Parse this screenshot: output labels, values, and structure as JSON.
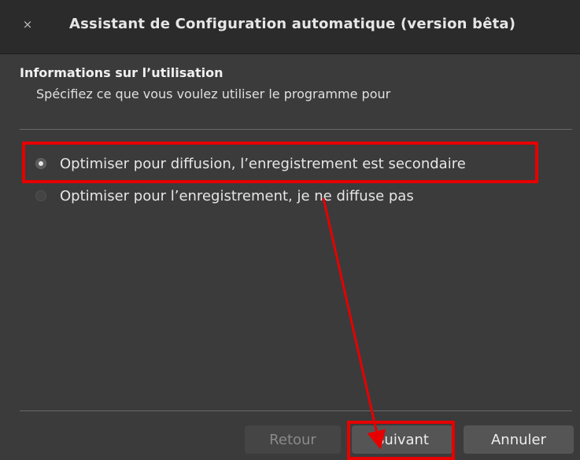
{
  "window": {
    "title": "Assistant de Configuration automatique (version bêta)",
    "close_symbol": "×"
  },
  "section": {
    "title": "Informations sur l’utilisation",
    "subtitle": "Spécifiez ce que vous voulez utiliser le programme pour"
  },
  "options": [
    {
      "label": "Optimiser pour diffusion, l’enregistrement est secondaire",
      "selected": true
    },
    {
      "label": "Optimiser pour l’enregistrement, je ne diffuse pas",
      "selected": false
    }
  ],
  "buttons": {
    "back": "Retour",
    "next": "Suivant",
    "cancel": "Annuler"
  },
  "colors": {
    "window_bg": "#3b3b3b",
    "titlebar_bg": "#2b2b2b",
    "annotation_red": "#e60000"
  },
  "icons": {
    "close": "close-icon",
    "radio_selected": "radio-selected-icon",
    "radio_unselected": "radio-unselected-icon"
  }
}
